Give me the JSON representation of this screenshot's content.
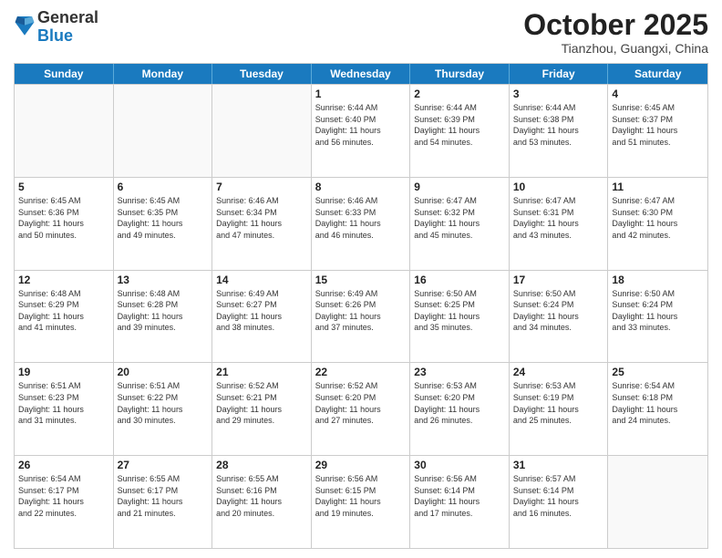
{
  "logo": {
    "general": "General",
    "blue": "Blue"
  },
  "title": "October 2025",
  "location": "Tianzhou, Guangxi, China",
  "weekdays": [
    "Sunday",
    "Monday",
    "Tuesday",
    "Wednesday",
    "Thursday",
    "Friday",
    "Saturday"
  ],
  "weeks": [
    [
      {
        "day": "",
        "info": ""
      },
      {
        "day": "",
        "info": ""
      },
      {
        "day": "",
        "info": ""
      },
      {
        "day": "1",
        "info": "Sunrise: 6:44 AM\nSunset: 6:40 PM\nDaylight: 11 hours\nand 56 minutes."
      },
      {
        "day": "2",
        "info": "Sunrise: 6:44 AM\nSunset: 6:39 PM\nDaylight: 11 hours\nand 54 minutes."
      },
      {
        "day": "3",
        "info": "Sunrise: 6:44 AM\nSunset: 6:38 PM\nDaylight: 11 hours\nand 53 minutes."
      },
      {
        "day": "4",
        "info": "Sunrise: 6:45 AM\nSunset: 6:37 PM\nDaylight: 11 hours\nand 51 minutes."
      }
    ],
    [
      {
        "day": "5",
        "info": "Sunrise: 6:45 AM\nSunset: 6:36 PM\nDaylight: 11 hours\nand 50 minutes."
      },
      {
        "day": "6",
        "info": "Sunrise: 6:45 AM\nSunset: 6:35 PM\nDaylight: 11 hours\nand 49 minutes."
      },
      {
        "day": "7",
        "info": "Sunrise: 6:46 AM\nSunset: 6:34 PM\nDaylight: 11 hours\nand 47 minutes."
      },
      {
        "day": "8",
        "info": "Sunrise: 6:46 AM\nSunset: 6:33 PM\nDaylight: 11 hours\nand 46 minutes."
      },
      {
        "day": "9",
        "info": "Sunrise: 6:47 AM\nSunset: 6:32 PM\nDaylight: 11 hours\nand 45 minutes."
      },
      {
        "day": "10",
        "info": "Sunrise: 6:47 AM\nSunset: 6:31 PM\nDaylight: 11 hours\nand 43 minutes."
      },
      {
        "day": "11",
        "info": "Sunrise: 6:47 AM\nSunset: 6:30 PM\nDaylight: 11 hours\nand 42 minutes."
      }
    ],
    [
      {
        "day": "12",
        "info": "Sunrise: 6:48 AM\nSunset: 6:29 PM\nDaylight: 11 hours\nand 41 minutes."
      },
      {
        "day": "13",
        "info": "Sunrise: 6:48 AM\nSunset: 6:28 PM\nDaylight: 11 hours\nand 39 minutes."
      },
      {
        "day": "14",
        "info": "Sunrise: 6:49 AM\nSunset: 6:27 PM\nDaylight: 11 hours\nand 38 minutes."
      },
      {
        "day": "15",
        "info": "Sunrise: 6:49 AM\nSunset: 6:26 PM\nDaylight: 11 hours\nand 37 minutes."
      },
      {
        "day": "16",
        "info": "Sunrise: 6:50 AM\nSunset: 6:25 PM\nDaylight: 11 hours\nand 35 minutes."
      },
      {
        "day": "17",
        "info": "Sunrise: 6:50 AM\nSunset: 6:24 PM\nDaylight: 11 hours\nand 34 minutes."
      },
      {
        "day": "18",
        "info": "Sunrise: 6:50 AM\nSunset: 6:24 PM\nDaylight: 11 hours\nand 33 minutes."
      }
    ],
    [
      {
        "day": "19",
        "info": "Sunrise: 6:51 AM\nSunset: 6:23 PM\nDaylight: 11 hours\nand 31 minutes."
      },
      {
        "day": "20",
        "info": "Sunrise: 6:51 AM\nSunset: 6:22 PM\nDaylight: 11 hours\nand 30 minutes."
      },
      {
        "day": "21",
        "info": "Sunrise: 6:52 AM\nSunset: 6:21 PM\nDaylight: 11 hours\nand 29 minutes."
      },
      {
        "day": "22",
        "info": "Sunrise: 6:52 AM\nSunset: 6:20 PM\nDaylight: 11 hours\nand 27 minutes."
      },
      {
        "day": "23",
        "info": "Sunrise: 6:53 AM\nSunset: 6:20 PM\nDaylight: 11 hours\nand 26 minutes."
      },
      {
        "day": "24",
        "info": "Sunrise: 6:53 AM\nSunset: 6:19 PM\nDaylight: 11 hours\nand 25 minutes."
      },
      {
        "day": "25",
        "info": "Sunrise: 6:54 AM\nSunset: 6:18 PM\nDaylight: 11 hours\nand 24 minutes."
      }
    ],
    [
      {
        "day": "26",
        "info": "Sunrise: 6:54 AM\nSunset: 6:17 PM\nDaylight: 11 hours\nand 22 minutes."
      },
      {
        "day": "27",
        "info": "Sunrise: 6:55 AM\nSunset: 6:17 PM\nDaylight: 11 hours\nand 21 minutes."
      },
      {
        "day": "28",
        "info": "Sunrise: 6:55 AM\nSunset: 6:16 PM\nDaylight: 11 hours\nand 20 minutes."
      },
      {
        "day": "29",
        "info": "Sunrise: 6:56 AM\nSunset: 6:15 PM\nDaylight: 11 hours\nand 19 minutes."
      },
      {
        "day": "30",
        "info": "Sunrise: 6:56 AM\nSunset: 6:14 PM\nDaylight: 11 hours\nand 17 minutes."
      },
      {
        "day": "31",
        "info": "Sunrise: 6:57 AM\nSunset: 6:14 PM\nDaylight: 11 hours\nand 16 minutes."
      },
      {
        "day": "",
        "info": ""
      }
    ]
  ]
}
